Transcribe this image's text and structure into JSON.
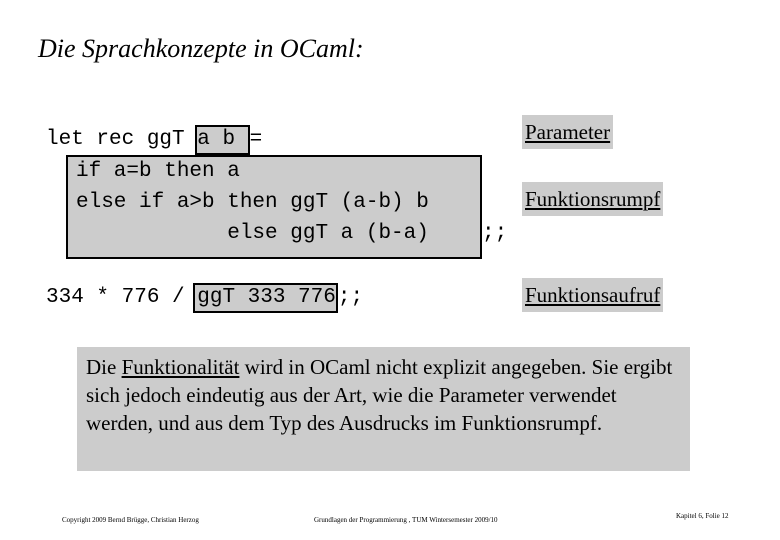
{
  "slide": {
    "title": "Die Sprachkonzepte in OCaml:",
    "code": {
      "line1_prefix": "let rec ggT ",
      "line1_params": "a b ",
      "line1_suffix": "=",
      "body_lines": [
        "if a=b then a",
        "else if a>b then ggT (a-b) b",
        "            else ggT a (b-a)"
      ],
      "body_terminator": ";;",
      "call_prefix": "334 * 776 / ",
      "call_expr": "ggT 333 776",
      "call_terminator": ";;"
    },
    "annotations": {
      "parameter": "Parameter",
      "function_body": "Funktionsrumpf",
      "function_call": "Funktionsaufruf"
    },
    "explanation": {
      "lead": "Die ",
      "underlined": "Funktionalität",
      "rest": " wird in OCaml nicht explizit angegeben. Sie ergibt sich jedoch eindeutig aus der Art, wie die Parameter verwendet werden, und aus dem Typ des Ausdrucks im Funktionsrumpf."
    },
    "footer": {
      "copyright": "Copyright 2009 Bernd Brügge, Christian Herzog",
      "course": "Grundlagen der Programmierung , TUM Wintersemester 2009/10",
      "page": "Kapitel 6, Folie 12"
    },
    "colors": {
      "highlight": "#cccccc",
      "text": "#000000",
      "background": "#ffffff"
    }
  }
}
